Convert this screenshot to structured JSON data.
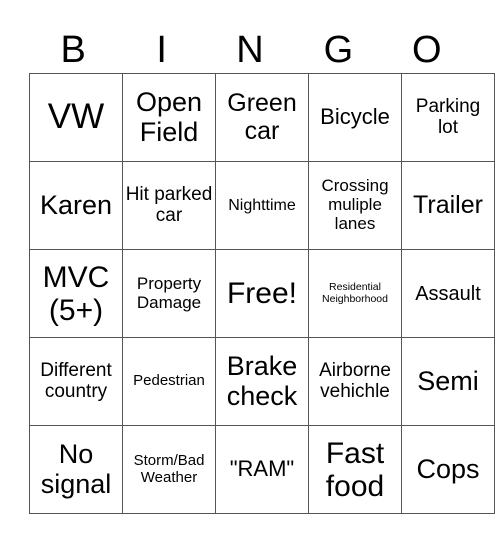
{
  "header": {
    "letters": [
      "B",
      "I",
      "N",
      "G",
      "O"
    ]
  },
  "board": {
    "rows": [
      [
        "VW",
        "Open Field",
        "Green car",
        "Bicycle",
        "Parking lot"
      ],
      [
        "Karen",
        "Hit parked car",
        "Nighttime",
        "Crossing muliple lanes",
        "Trailer"
      ],
      [
        "MVC (5+)",
        "Property Damage",
        "Free!",
        "Residential Neighborhood",
        "Assault"
      ],
      [
        "Different country",
        "Pedestrian",
        "Brake check",
        "Airborne vehichle",
        "Semi"
      ],
      [
        "No signal",
        "Storm/Bad Weather",
        "\"RAM\"",
        "Fast food",
        "Cops"
      ]
    ]
  }
}
